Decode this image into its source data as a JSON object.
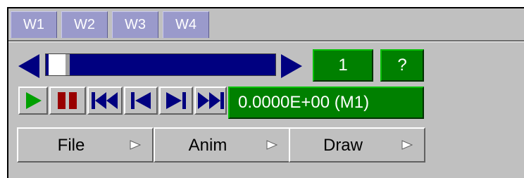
{
  "tabs": [
    {
      "label": "W1"
    },
    {
      "label": "W2"
    },
    {
      "label": "W3"
    },
    {
      "label": "W4"
    }
  ],
  "slider": {
    "position_fraction": 0.0
  },
  "frame": {
    "value": "1",
    "help_label": "?"
  },
  "playback": {
    "time_display": "0.0000E+00 (M1)",
    "buttons": [
      "play-icon",
      "pause-icon",
      "rewind-icon",
      "step-back-icon",
      "step-forward-icon",
      "fast-forward-icon"
    ]
  },
  "menu": [
    {
      "label": "File"
    },
    {
      "label": "Anim"
    },
    {
      "label": "Draw"
    }
  ],
  "colors": {
    "panel": "#c0c0c0",
    "tab": "#9a9acb",
    "track": "#000080",
    "display_green": "#008000",
    "play_green": "#00a000",
    "pause_red": "#990000",
    "transport_navy": "#000080"
  }
}
